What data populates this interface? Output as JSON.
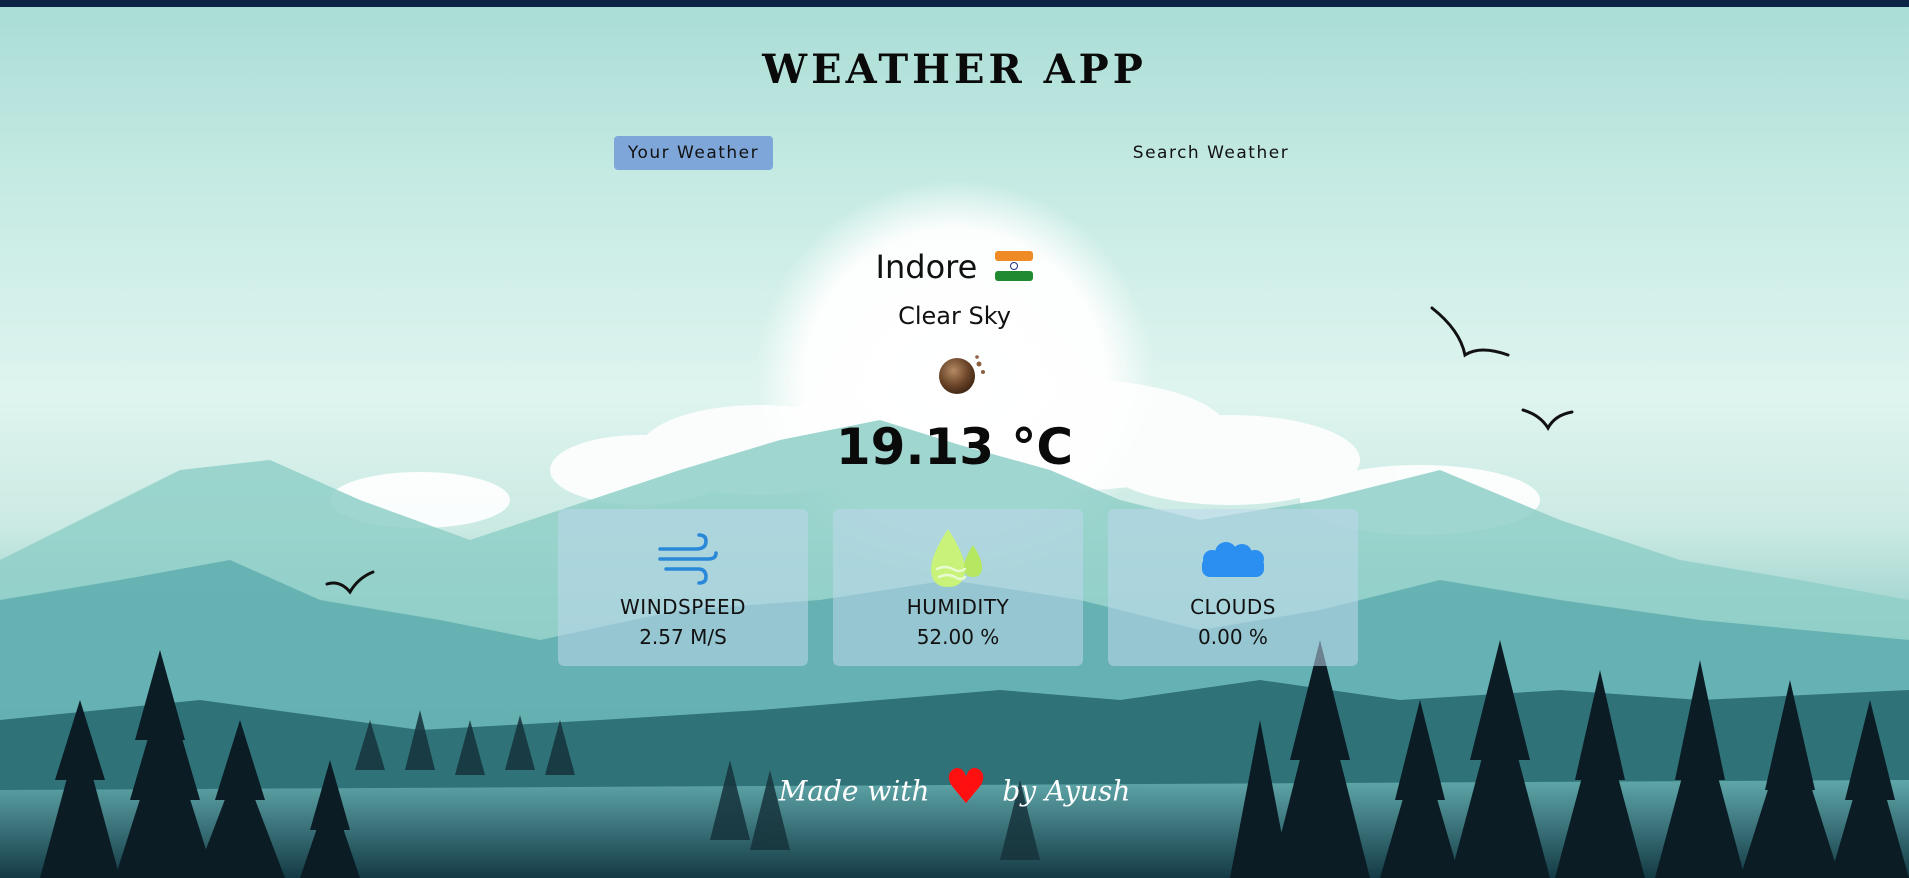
{
  "app": {
    "title": "WEATHER APP"
  },
  "tabs": {
    "user_label": "Your Weather",
    "search_label": "Search Weather",
    "active": "Your Weather"
  },
  "weather": {
    "city": "Indore",
    "country_flag": "india-flag-icon",
    "description": "Clear Sky",
    "icon": "weather-condition-icon",
    "temperature": "19.13 °C"
  },
  "cards": {
    "windspeed": {
      "label": "WINDSPEED",
      "value": "2.57 M/S",
      "icon": "wind-icon"
    },
    "humidity": {
      "label": "HUMIDITY",
      "value": "52.00 %",
      "icon": "humidity-drop-icon"
    },
    "clouds": {
      "label": "CLOUDS",
      "value": "0.00 %",
      "icon": "cloud-icon"
    }
  },
  "footer": {
    "prefix": "Made with",
    "suffix": "by Ayush"
  },
  "colors": {
    "topbar": "#0c2346",
    "active_tab": "#7fa6d8",
    "heart": "#ff1010"
  }
}
